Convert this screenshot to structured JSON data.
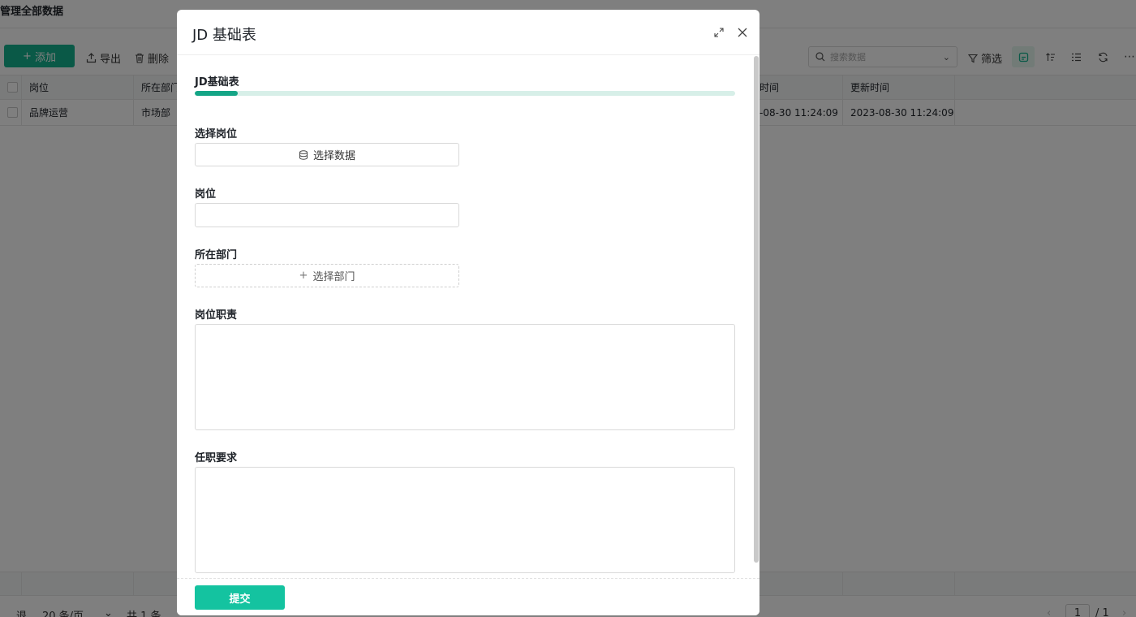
{
  "app": {
    "title": "管理全部数据",
    "toolbar": {
      "add": "添加",
      "export": "导出",
      "delete": "删除",
      "search_placeholder": "搜索数据",
      "filter": "筛选"
    },
    "table": {
      "columns": [
        "岗位",
        "所在部门",
        "时间",
        "更新时间"
      ],
      "rows": [
        {
          "position": "品牌运营",
          "department": "市场部",
          "created": "-08-30 11:24:09",
          "updated": "2023-08-30 11:24:09"
        }
      ]
    },
    "pager": {
      "left_partial": "退",
      "page_size": "20 条/页",
      "total": "共 1 条",
      "current_page": "1",
      "total_pages": "/ 1"
    }
  },
  "modal": {
    "title": "JD 基础表",
    "section_title": "JD基础表",
    "progress": 0.08,
    "fields": {
      "select_position_label": "选择岗位",
      "select_data_button": "选择数据",
      "position_label": "岗位",
      "position_value": "",
      "department_label": "所在部门",
      "select_department_button": "选择部门",
      "duties_label": "岗位职责",
      "duties_value": "",
      "requirements_label": "任职要求",
      "requirements_value": ""
    },
    "submit": "提交"
  },
  "colors": {
    "accent": "#14b38e",
    "submit": "#14c3a0",
    "progress_fill": "#14a586"
  }
}
